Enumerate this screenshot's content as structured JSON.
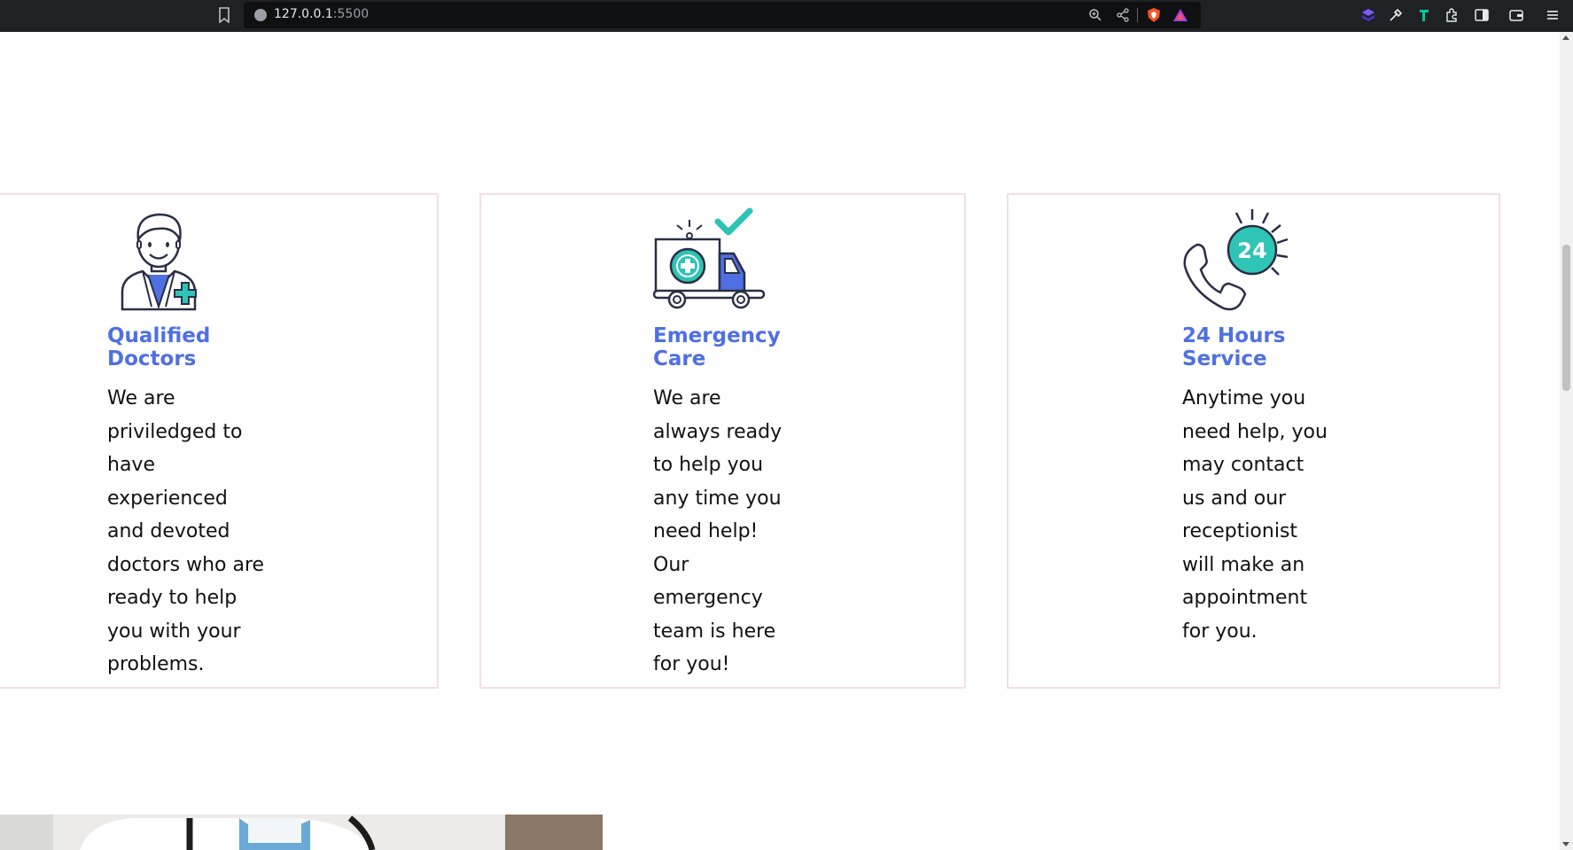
{
  "browser": {
    "url_host": "127.0.0.1",
    "url_port": ":5500"
  },
  "cards": [
    {
      "title": "Qualified\nDoctors",
      "body": "We are\npriviledged to\nhave\nexperienced\nand devoted\ndoctors who are\nready to help\nyou with your\nproblems.",
      "icon": "doctor-icon"
    },
    {
      "title": "Emergency\nCare",
      "body": "We are\nalways ready\nto help you\nany time you\nneed help!\nOur\nemergency\nteam is here\nfor you!",
      "icon": "ambulance-icon"
    },
    {
      "title": "24 Hours\nService",
      "body": "Anytime you\nneed help, you\nmay contact\nus and our\nreceptionist\nwill make an\nappointment\nfor you.",
      "icon": "phone-24-icon",
      "icon_label": "24"
    }
  ],
  "colors": {
    "accent_blue": "#4f6fe3",
    "teal": "#2ec4b6",
    "card_border": "#f6dfe4"
  }
}
